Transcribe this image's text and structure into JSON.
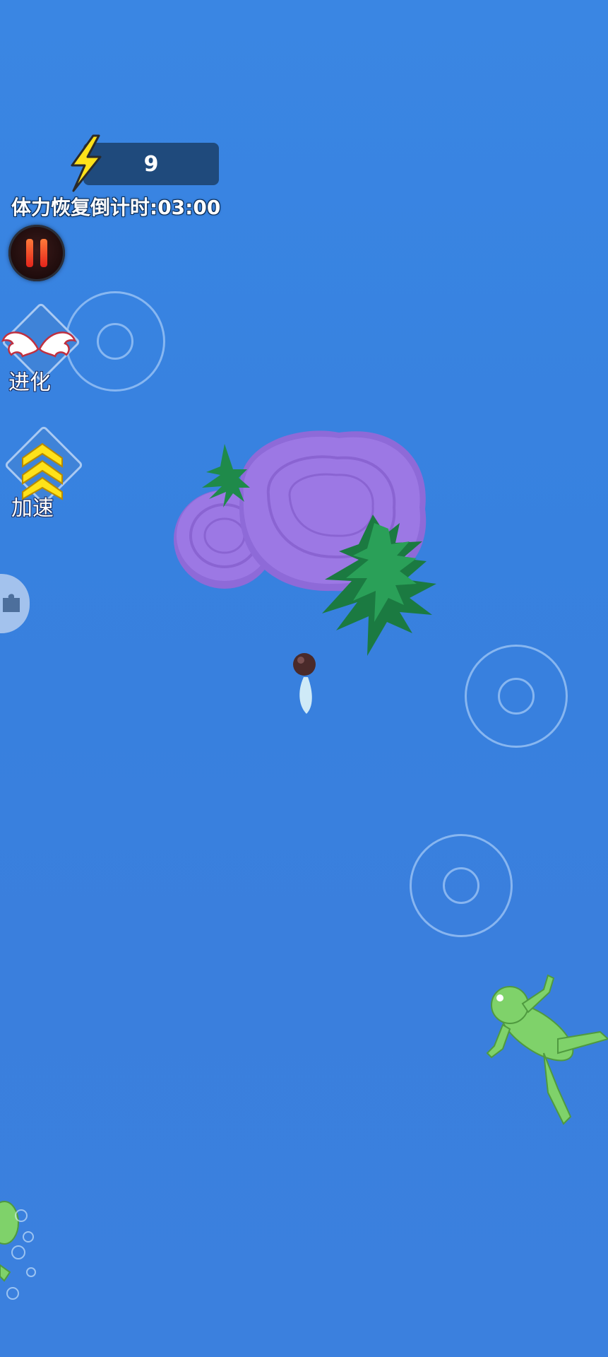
{
  "hud": {
    "energy_value": "9",
    "countdown_text": "体力恢复倒计时:03:00"
  },
  "skills": {
    "evolve_label": "进化",
    "speed_label": "加速"
  },
  "colors": {
    "water": "#3a86e3",
    "energy_bar": "#1f4a7c",
    "bolt": "#ffe21a",
    "pause_bar": "#ff5a2a",
    "rock": "#9a74e0",
    "plant": "#1f8a4a",
    "frog": "#7fd26a"
  },
  "icons": {
    "energy": "lightning-bolt-icon",
    "pause": "pause-icon",
    "evolve": "angel-wings-icon",
    "speed": "double-chevron-up-icon",
    "side_tab": "puzzle-icon"
  }
}
